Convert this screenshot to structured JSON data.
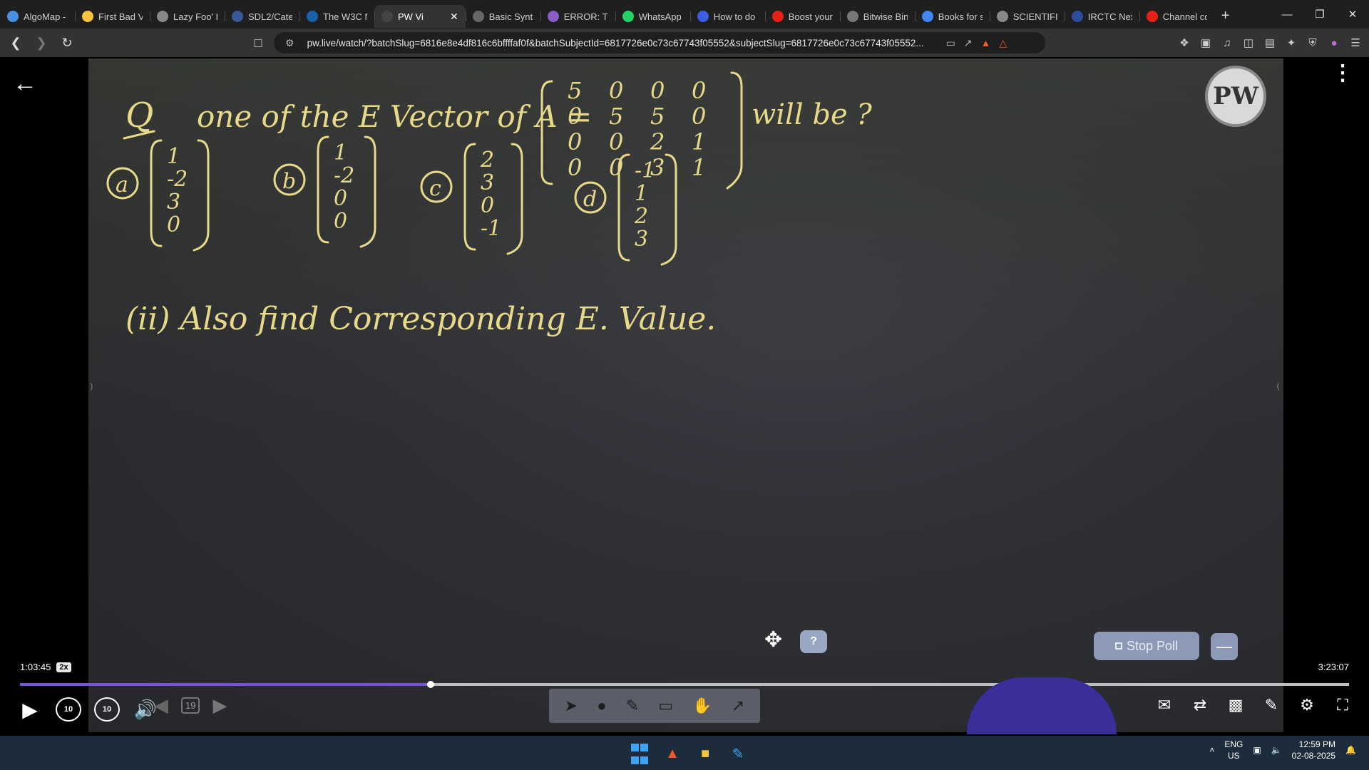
{
  "browser": {
    "tabs": [
      {
        "title": "AlgoMap -",
        "icon": "algomap-icon",
        "color": "#4a90e2"
      },
      {
        "title": "First Bad V",
        "icon": "lightning-icon",
        "color": "#f5c542"
      },
      {
        "title": "Lazy Foo' P",
        "icon": "globe-icon",
        "color": "#888888"
      },
      {
        "title": "SDL2/Cate",
        "icon": "sdl-icon",
        "color": "#3b5998"
      },
      {
        "title": "The W3C N",
        "icon": "w3c-icon",
        "color": "#1a5fa8"
      },
      {
        "title": "PW Vi",
        "icon": "pw-icon",
        "color": "#444444",
        "active": true
      },
      {
        "title": "Basic Synta",
        "icon": "doc-icon",
        "color": "#666666"
      },
      {
        "title": "ERROR: Th",
        "icon": "error-icon",
        "color": "#8a5cc8"
      },
      {
        "title": "WhatsApp",
        "icon": "whatsapp-icon",
        "color": "#25d366"
      },
      {
        "title": "How to do",
        "icon": "circle-icon",
        "color": "#3b5fe0"
      },
      {
        "title": "Boost your",
        "icon": "youtube-icon",
        "color": "#e62117"
      },
      {
        "title": "Bitwise Bin",
        "icon": "bitwise-icon",
        "color": "#777777"
      },
      {
        "title": "Books for s",
        "icon": "google-icon",
        "color": "#4285f4"
      },
      {
        "title": "SCIENTIFIC",
        "icon": "globe-icon",
        "color": "#888888"
      },
      {
        "title": "IRCTC Nex",
        "icon": "irctc-icon",
        "color": "#2b4e9f"
      },
      {
        "title": "Channel cc",
        "icon": "youtube-icon",
        "color": "#e62117"
      }
    ],
    "new_tab": "+",
    "url": "pw.live/watch/?batchSlug=6816e8e4df816c6bffffaf0f&batchSubjectId=6817726e0c73c67743f05552&subjectSlug=6817726e0c73c67743f05552..."
  },
  "player": {
    "current_time": "1:03:45",
    "speed": "2x",
    "duration": "3:23:07",
    "progress_fraction": 0.309,
    "stop_poll_label": "Stop Poll",
    "help_label": "?",
    "minimize_label": "—",
    "logo_text": "PW",
    "skip_back_label": "10",
    "skip_fwd_label": "10",
    "page_badge": "19"
  },
  "board": {
    "question_prefix": "Q",
    "question_text": "one of the E Vector of A =",
    "matrix": [
      [
        "5",
        "0",
        "0",
        "0"
      ],
      [
        "0",
        "5",
        "5",
        "0"
      ],
      [
        "0",
        "0",
        "2",
        "1"
      ],
      [
        "0",
        "0",
        "3",
        "1"
      ]
    ],
    "question_suffix": "will be ?",
    "options": [
      {
        "label": "a",
        "vector": [
          "1",
          "-2",
          "3",
          "0"
        ]
      },
      {
        "label": "b",
        "vector": [
          "1",
          "-2",
          "0",
          "0"
        ]
      },
      {
        "label": "c",
        "vector": [
          "2",
          "3",
          "0",
          "-1"
        ]
      },
      {
        "label": "d",
        "vector": [
          "-1",
          "1",
          "2",
          "3"
        ]
      }
    ],
    "part_two": "(ii) Also find Corresponding E. Value."
  },
  "taskbar": {
    "lang_line1": "ENG",
    "lang_line2": "US",
    "time": "12:59 PM",
    "date": "02-08-2025"
  }
}
